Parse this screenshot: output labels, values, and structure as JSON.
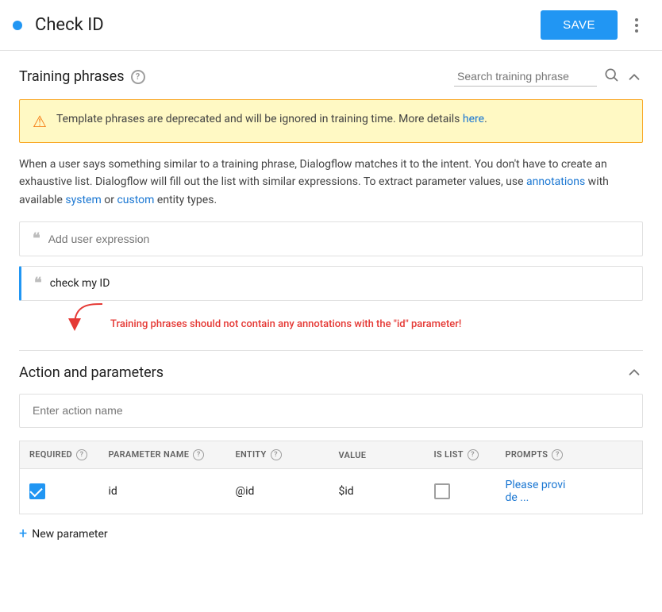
{
  "header": {
    "dot_color": "#2196F3",
    "title": "Check ID",
    "save_label": "SAVE"
  },
  "training_phrases": {
    "section_title": "Training phrases",
    "search_placeholder": "Search training phrase",
    "warning": {
      "text": "Template phrases are deprecated and will be ignored in training time. More details ",
      "link_text": "here",
      "link_suffix": "."
    },
    "description_parts": [
      "When a user says something similar to a training phrase, Dialogflow matches it to the intent. You don't have to create an exhaustive list. Dialogflow will fill out the list with similar expressions. To extract parameter values, use ",
      "annotations",
      " with available ",
      "system",
      " or ",
      "custom",
      " entity types."
    ],
    "add_expression_placeholder": "Add user expression",
    "phrase": "check my ID",
    "annotation_warning": "Training phrases should not contain any annotations with the \"id\" parameter!"
  },
  "action_and_parameters": {
    "section_title": "Action and parameters",
    "action_placeholder": "Enter action name",
    "table": {
      "columns": [
        {
          "label": "REQUIRED",
          "has_help": true
        },
        {
          "label": "PARAMETER NAME",
          "has_help": true
        },
        {
          "label": "ENTITY",
          "has_help": true
        },
        {
          "label": "VALUE",
          "has_help": false
        },
        {
          "label": "IS LIST",
          "has_help": true
        },
        {
          "label": "PROMPTS",
          "has_help": true
        }
      ],
      "rows": [
        {
          "required": true,
          "param_name": "id",
          "entity": "@id",
          "value": "$id",
          "is_list": false,
          "prompts_text": "Please provide ..."
        }
      ]
    },
    "new_parameter_label": "New parameter"
  }
}
